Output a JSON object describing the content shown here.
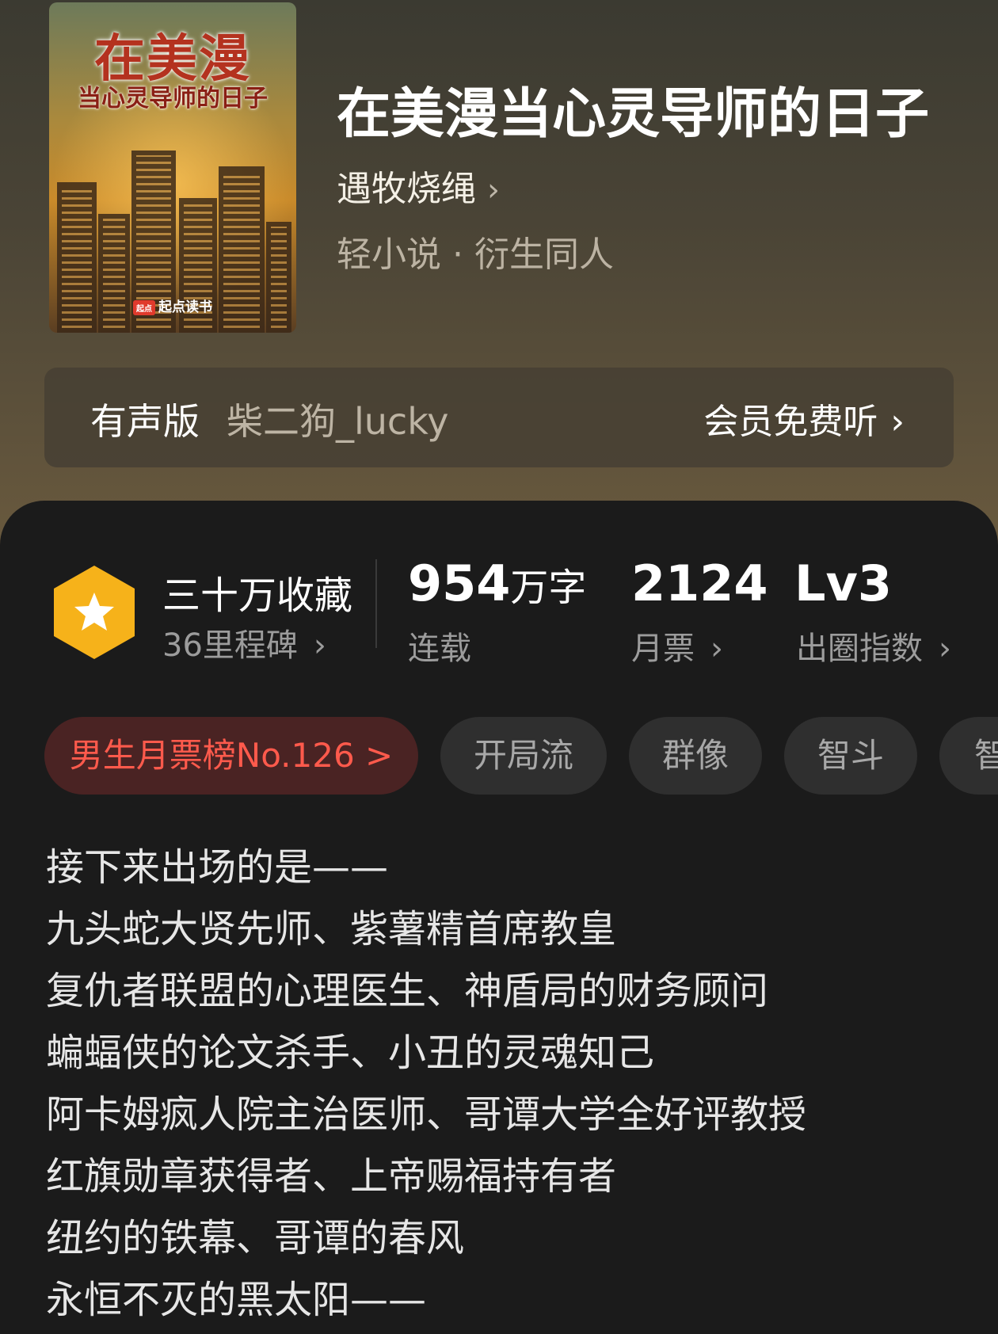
{
  "book": {
    "title": "在美漫当心灵导师的日子",
    "author": "遇牧烧绳",
    "genre": "轻小说 · 衍生同人"
  },
  "cover": {
    "title": "在美漫",
    "subtitle": "当心灵导师的日子",
    "publisher": "起点读书",
    "publisher_mark": "起点"
  },
  "audio": {
    "label": "有声版",
    "narrator": "柴二狗_lucky",
    "action": "会员免费听"
  },
  "stats": {
    "collection": {
      "title": "三十万收藏",
      "sub": "36里程碑"
    },
    "words": {
      "number": "954",
      "unit": "万字",
      "sub": "连载"
    },
    "tickets": {
      "number": "2124",
      "sub": "月票"
    },
    "level": {
      "number": "Lv3",
      "sub": "出圈指数"
    }
  },
  "tags": {
    "rank": "男生月票榜No.126 >",
    "items": [
      "开局流",
      "群像",
      "智斗",
      "智"
    ]
  },
  "blurb": [
    "接下来出场的是——",
    "九头蛇大贤先师、紫薯精首席教皇",
    "复仇者联盟的心理医生、神盾局的财务顾问",
    "蝙蝠侠的论文杀手、小丑的灵魂知己",
    "阿卡姆疯人院主治医师、哥谭大学全好评教授",
    "红旗勋章获得者、上帝赐福持有者",
    "纽约的铁幕、哥谭的春风",
    "永恒不灭的黑太阳——"
  ],
  "icons": {
    "badge": "star-hexagon-icon",
    "chevron": "chevron-right-icon"
  },
  "colors": {
    "badge": "#f6b21a",
    "rank_text": "#ff5a4c",
    "rank_bg": "#4a2323",
    "panel_bg": "#1b1b1b"
  }
}
